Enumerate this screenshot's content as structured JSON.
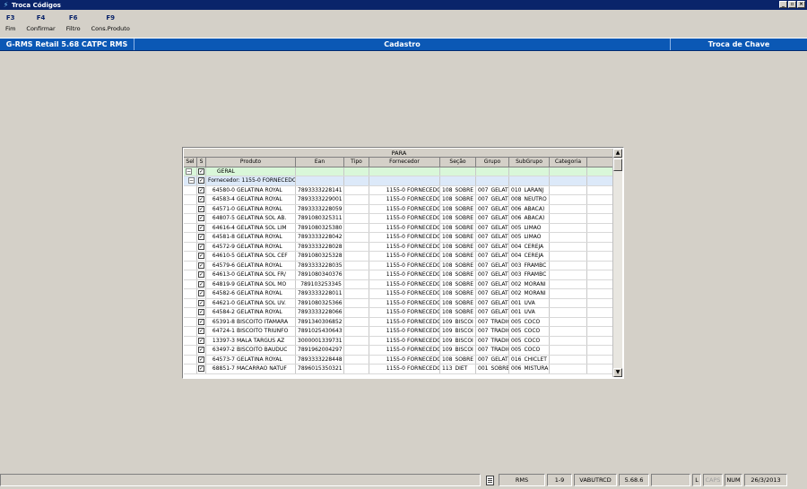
{
  "window": {
    "title": "Troca Códigos",
    "title_icon": "app-icon",
    "buttons": [
      "_",
      "▫",
      "×"
    ]
  },
  "toolbar": [
    {
      "key": "F3",
      "label": "Fim"
    },
    {
      "key": "F4",
      "label": "Confirmar"
    },
    {
      "key": "F6",
      "label": "Filtro"
    },
    {
      "key": "F9",
      "label": "Cons.Produto"
    }
  ],
  "header": {
    "left": "G-RMS Retail 5.68 CATPC RMS",
    "center": "Cadastro",
    "right": "Troca de Chave"
  },
  "grid": {
    "group_header": "PARA",
    "columns": [
      "Sel",
      "S",
      "Produto",
      "Ean",
      "Tipo",
      "Fornecedor",
      "Seção",
      "Grupo",
      "SubGrupo",
      "Categoria"
    ],
    "geral_label": "GERAL",
    "fornecedor_label": "Fornecedor: 1155-0 FORNECEDO",
    "rows": [
      {
        "code": "64580-0",
        "name": "GELATINA ROYAL",
        "ean": "7893333228141",
        "forn": "1155-0",
        "forn_name": "FORNECEDO",
        "sec": "108",
        "sec_name": "SOBRE",
        "grp": "007",
        "grp_name": "GELAT",
        "sub": "010",
        "sub_name": "LARANJ"
      },
      {
        "code": "64583-4",
        "name": "GELATINA ROYAL",
        "ean": "7893333229001",
        "forn": "1155-0",
        "forn_name": "FORNECEDO",
        "sec": "108",
        "sec_name": "SOBRE",
        "grp": "007",
        "grp_name": "GELAT",
        "sub": "008",
        "sub_name": "NEUTRO"
      },
      {
        "code": "64571-0",
        "name": "GELATINA ROYAL",
        "ean": "7893333228059",
        "forn": "1155-0",
        "forn_name": "FORNECEDO",
        "sec": "108",
        "sec_name": "SOBRE",
        "grp": "007",
        "grp_name": "GELAT",
        "sub": "006",
        "sub_name": "ABACA)"
      },
      {
        "code": "64807-5",
        "name": "GELATINA SOL AB.",
        "ean": "7891080325311",
        "forn": "1155-0",
        "forn_name": "FORNECEDO",
        "sec": "108",
        "sec_name": "SOBRE",
        "grp": "007",
        "grp_name": "GELAT",
        "sub": "006",
        "sub_name": "ABACA)"
      },
      {
        "code": "64616-4",
        "name": "GELATINA SOL LIM",
        "ean": "7891080325380",
        "forn": "1155-0",
        "forn_name": "FORNECEDO",
        "sec": "108",
        "sec_name": "SOBRE",
        "grp": "007",
        "grp_name": "GELAT",
        "sub": "005",
        "sub_name": "LIMAO"
      },
      {
        "code": "64581-8",
        "name": "GELATINA ROYAL",
        "ean": "7893333228042",
        "forn": "1155-0",
        "forn_name": "FORNECEDO",
        "sec": "108",
        "sec_name": "SOBRE",
        "grp": "007",
        "grp_name": "GELAT",
        "sub": "005",
        "sub_name": "LIMAO"
      },
      {
        "code": "64572-9",
        "name": "GELATINA ROYAL",
        "ean": "7893333228028",
        "forn": "1155-0",
        "forn_name": "FORNECEDO",
        "sec": "108",
        "sec_name": "SOBRE",
        "grp": "007",
        "grp_name": "GELAT",
        "sub": "004",
        "sub_name": "CEREJA"
      },
      {
        "code": "64610-5",
        "name": "GELATINA SOL CEF",
        "ean": "7891080325328",
        "forn": "1155-0",
        "forn_name": "FORNECEDO",
        "sec": "108",
        "sec_name": "SOBRE",
        "grp": "007",
        "grp_name": "GELAT",
        "sub": "004",
        "sub_name": "CEREJA"
      },
      {
        "code": "64579-6",
        "name": "GELATINA ROYAL",
        "ean": "7893333228035",
        "forn": "1155-0",
        "forn_name": "FORNECEDO",
        "sec": "108",
        "sec_name": "SOBRE",
        "grp": "007",
        "grp_name": "GELAT",
        "sub": "003",
        "sub_name": "FRAMBC"
      },
      {
        "code": "64613-0",
        "name": "GELATINA SOL FR/",
        "ean": "7891080340376",
        "forn": "1155-0",
        "forn_name": "FORNECEDO",
        "sec": "108",
        "sec_name": "SOBRE",
        "grp": "007",
        "grp_name": "GELAT",
        "sub": "003",
        "sub_name": "FRAMBC"
      },
      {
        "code": "64819-9",
        "name": "GELATINA SOL MO",
        "ean": "789103253345",
        "forn": "1155-0",
        "forn_name": "FORNECEDO",
        "sec": "108",
        "sec_name": "SOBRE",
        "grp": "007",
        "grp_name": "GELAT",
        "sub": "002",
        "sub_name": "MORANI"
      },
      {
        "code": "64582-6",
        "name": "GELATINA ROYAL",
        "ean": "7893333228011",
        "forn": "1155-0",
        "forn_name": "FORNECEDO",
        "sec": "108",
        "sec_name": "SOBRE",
        "grp": "007",
        "grp_name": "GELAT",
        "sub": "002",
        "sub_name": "MORANI"
      },
      {
        "code": "64621-0",
        "name": "GELATINA SOL UV.",
        "ean": "7891080325366",
        "forn": "1155-0",
        "forn_name": "FORNECEDO",
        "sec": "108",
        "sec_name": "SOBRE",
        "grp": "007",
        "grp_name": "GELAT",
        "sub": "001",
        "sub_name": "UVA"
      },
      {
        "code": "64584-2",
        "name": "GELATINA ROYAL",
        "ean": "7893333228066",
        "forn": "1155-0",
        "forn_name": "FORNECEDO",
        "sec": "108",
        "sec_name": "SOBRE",
        "grp": "007",
        "grp_name": "GELAT",
        "sub": "001",
        "sub_name": "UVA"
      },
      {
        "code": "65391-8",
        "name": "BISCOITO ITAMARA",
        "ean": "7891340306852",
        "forn": "1155-0",
        "forn_name": "FORNECEDO",
        "sec": "109",
        "sec_name": "BISCOI",
        "grp": "007",
        "grp_name": "TRADIC",
        "sub": "005",
        "sub_name": "COCO"
      },
      {
        "code": "64724-1",
        "name": "BISCOITO TRIUNFO",
        "ean": "7891025430643",
        "forn": "1155-0",
        "forn_name": "FORNECEDO",
        "sec": "109",
        "sec_name": "BISCOI",
        "grp": "007",
        "grp_name": "TRADIC",
        "sub": "005",
        "sub_name": "COCO"
      },
      {
        "code": "13397-3",
        "name": "MALA TARGUS AZ",
        "ean": "3000001339731",
        "forn": "1155-0",
        "forn_name": "FORNECEDO",
        "sec": "109",
        "sec_name": "BISCOI",
        "grp": "007",
        "grp_name": "TRADIC",
        "sub": "005",
        "sub_name": "COCO"
      },
      {
        "code": "63497-2",
        "name": "BISCOITO BAUDUC",
        "ean": "7891962004297",
        "forn": "1155-0",
        "forn_name": "FORNECEDO",
        "sec": "109",
        "sec_name": "BISCOI",
        "grp": "007",
        "grp_name": "TRADIC",
        "sub": "005",
        "sub_name": "COCO"
      },
      {
        "code": "64573-7",
        "name": "GELATINA ROYAL",
        "ean": "7893333228448",
        "forn": "1155-0",
        "forn_name": "FORNECEDO",
        "sec": "108",
        "sec_name": "SOBRE",
        "grp": "007",
        "grp_name": "GELAT",
        "sub": "016",
        "sub_name": "CHICLET"
      },
      {
        "code": "68851-7",
        "name": "MACARRAO NATUF",
        "ean": "7896015350321",
        "forn": "1155-0",
        "forn_name": "FORNECEDO",
        "sec": "113",
        "sec_name": "DIET",
        "grp": "001",
        "grp_name": "SOBRE",
        "sub": "006",
        "sub_name": "MISTURA"
      }
    ]
  },
  "status": {
    "system": "RMS",
    "range": "1-9",
    "user": "VABUTRCD",
    "version": "5.68.6",
    "l": "L",
    "caps": "CAPS",
    "num": "NUM",
    "date": "26/3/2013"
  }
}
